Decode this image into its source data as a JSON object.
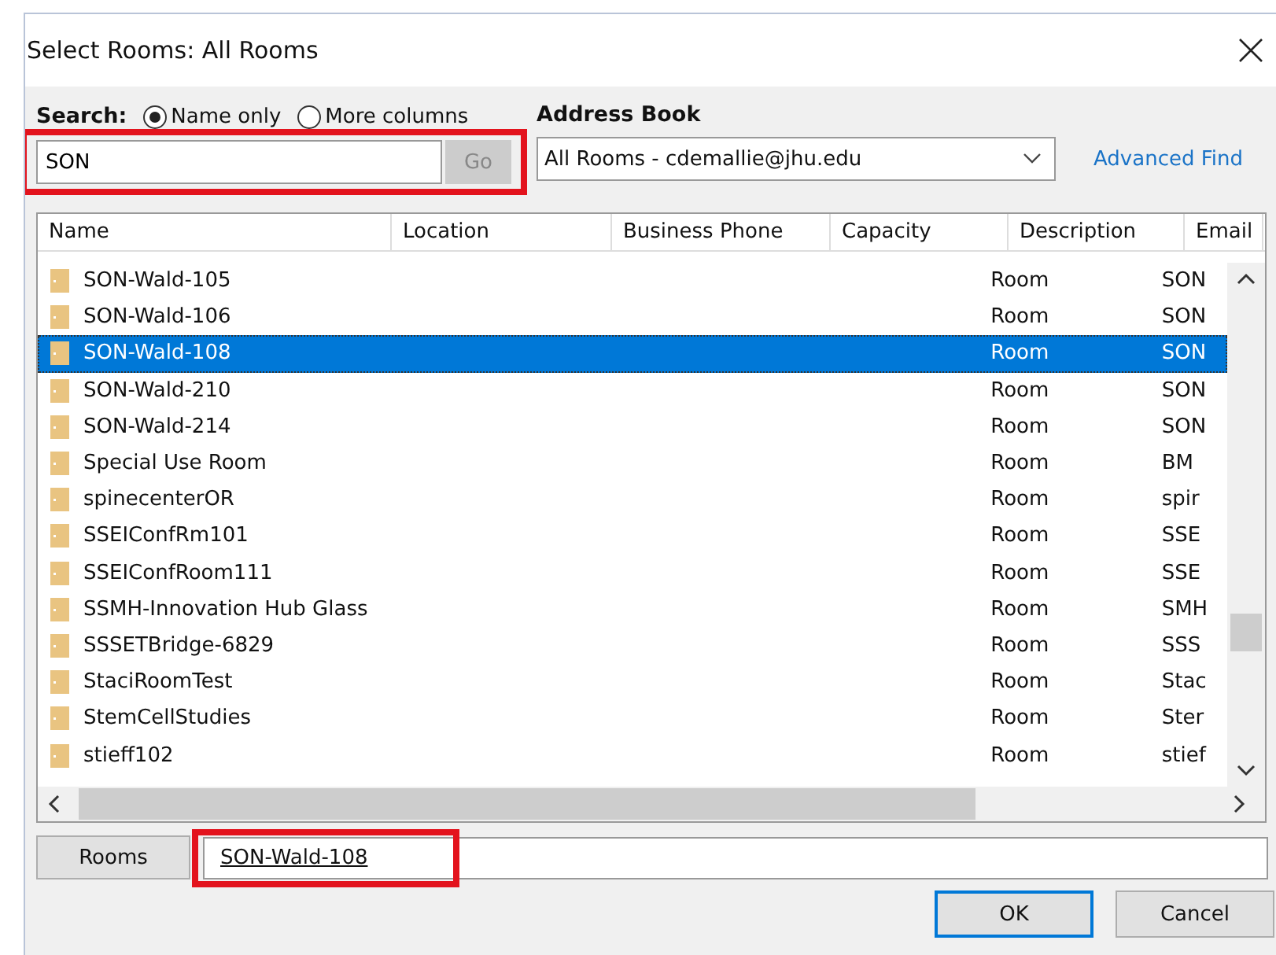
{
  "window": {
    "title": "Select Rooms: All Rooms"
  },
  "search": {
    "label": "Search:",
    "options": [
      {
        "label": "Name only",
        "selected": true
      },
      {
        "label": "More columns",
        "selected": false
      }
    ],
    "value": "SON",
    "go_button": "Go",
    "go_disabled": true,
    "highlighted": true
  },
  "address_book": {
    "label": "Address Book",
    "value": "All Rooms - cdemallie@jhu.edu",
    "advanced_find": "Advanced Find"
  },
  "table": {
    "columns": [
      "Name",
      "Location",
      "Business Phone",
      "Capacity",
      "Description",
      "Email"
    ],
    "rows": [
      {
        "name": "SON-Wald-105",
        "description": "Room",
        "email": "SON",
        "selected": false
      },
      {
        "name": "SON-Wald-106",
        "description": "Room",
        "email": "SON",
        "selected": false
      },
      {
        "name": "SON-Wald-108",
        "description": "Room",
        "email": "SON",
        "selected": true
      },
      {
        "name": "SON-Wald-210",
        "description": "Room",
        "email": "SON",
        "selected": false
      },
      {
        "name": "SON-Wald-214",
        "description": "Room",
        "email": "SON",
        "selected": false
      },
      {
        "name": "Special Use Room",
        "description": "Room",
        "email": "BM",
        "selected": false
      },
      {
        "name": "spinecenterOR",
        "description": "Room",
        "email": "spir",
        "selected": false
      },
      {
        "name": "SSEIConfRm101",
        "description": "Room",
        "email": "SSE",
        "selected": false
      },
      {
        "name": "SSEIConfRoom111",
        "description": "Room",
        "email": "SSE",
        "selected": false
      },
      {
        "name": "SSMH-Innovation Hub Glass",
        "description": "Room",
        "email": "SMH",
        "selected": false
      },
      {
        "name": "SSSETBridge-6829",
        "description": "Room",
        "email": "SSS",
        "selected": false
      },
      {
        "name": "StaciRoomTest",
        "description": "Room",
        "email": "Stac",
        "selected": false
      },
      {
        "name": "StemCellStudies",
        "description": "Room",
        "email": "Ster",
        "selected": false
      },
      {
        "name": "stieff102",
        "description": "Room",
        "email": "stief",
        "selected": false
      }
    ]
  },
  "rooms_button": "Rooms",
  "rooms_field": {
    "value": "SON-Wald-108",
    "highlighted": true
  },
  "buttons": [
    "OK",
    "Cancel"
  ]
}
